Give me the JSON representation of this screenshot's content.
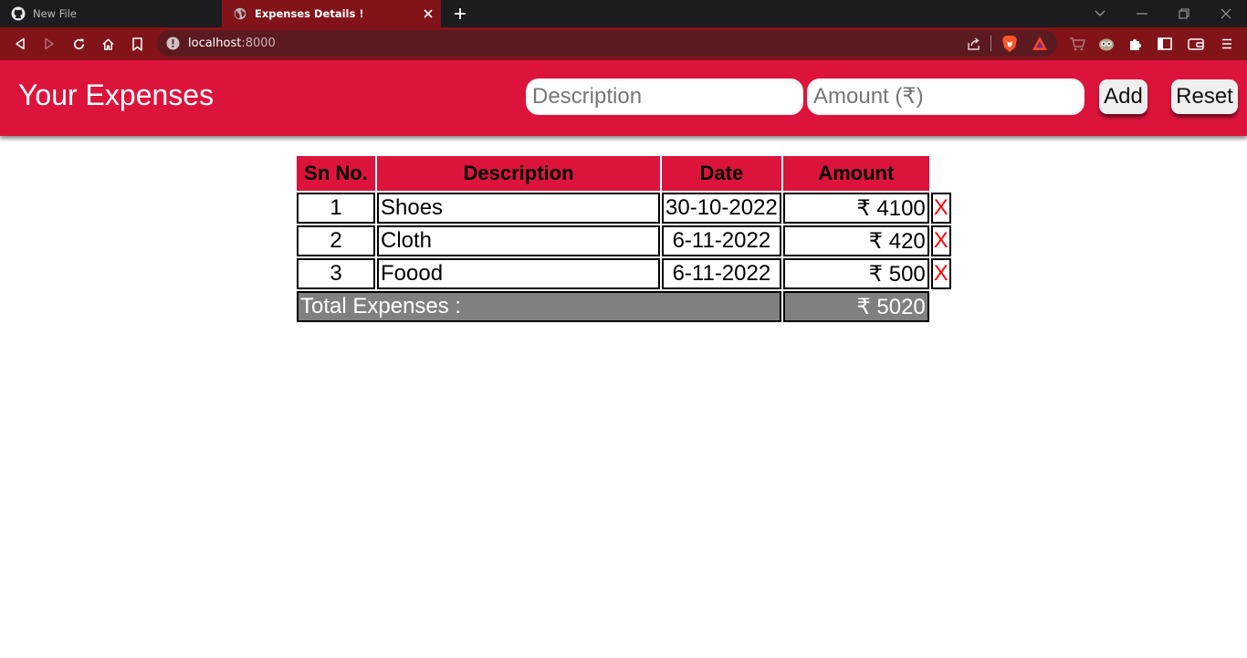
{
  "browser": {
    "tabs": [
      {
        "title": "New File",
        "active": false,
        "favicon": "github-icon"
      },
      {
        "title": "Expenses Details !",
        "active": true,
        "favicon": "globe-icon"
      }
    ],
    "address": {
      "host": "localhost",
      "port": ":8000"
    },
    "colors": {
      "tab_strip": "#1c1b1f",
      "toolbar": "#821419",
      "url_bar": "#5b1a20"
    }
  },
  "app": {
    "title": "Your Expenses",
    "form": {
      "description_placeholder": "Description",
      "description_value": "",
      "amount_placeholder": "Amount (₹)",
      "amount_value": "",
      "add_label": "Add",
      "reset_label": "Reset"
    },
    "colors": {
      "accent": "#dc143c",
      "total_bg": "#808080",
      "delete": "#ff0000"
    }
  },
  "table": {
    "headers": [
      "Sn No.",
      "Description",
      "Date",
      "Amount"
    ],
    "rows": [
      {
        "sn": "1",
        "description": "Shoes",
        "date": "30-10-2022",
        "amount": "₹ 4100",
        "delete": "X"
      },
      {
        "sn": "2",
        "description": "Cloth",
        "date": "6-11-2022",
        "amount": "₹ 420",
        "delete": "X"
      },
      {
        "sn": "3",
        "description": "Foood",
        "date": "6-11-2022",
        "amount": "₹ 500",
        "delete": "X"
      }
    ],
    "total": {
      "label": "Total Expenses :",
      "amount": "₹ 5020"
    }
  }
}
